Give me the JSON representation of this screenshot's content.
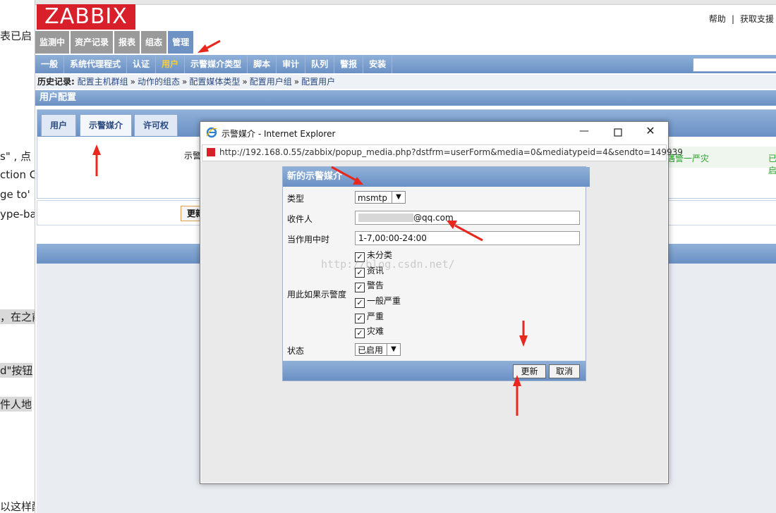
{
  "article_fragments": [
    "表已启",
    "s\" , 点",
    "ction C",
    "ge to'",
    "ype-ba",
    "，在之前",
    "d\"按钮",
    "件人地",
    "以这样配"
  ],
  "zabbix": {
    "logo": "ZABBIX",
    "top_links": {
      "help": "帮助",
      "separator": "|",
      "support": "获取支援"
    },
    "main_menu": [
      "监测中",
      "资产记录",
      "报表",
      "组态",
      "管理"
    ],
    "main_menu_active": "管理",
    "sub_menu": [
      "一般",
      "系统代理程式",
      "认证",
      "用户",
      "示警媒介类型",
      "脚本",
      "审计",
      "队列",
      "警报",
      "安装"
    ],
    "sub_menu_active": "用户",
    "history": {
      "label": "历史记录:",
      "crumbs": [
        "配置主机群组",
        "动作的组态",
        "配置媒体类型",
        "配置用户组",
        "配置用户"
      ],
      "separator": "»"
    },
    "page_title": "用户配置",
    "tabs": [
      "用户",
      "示警媒介",
      "许可权"
    ],
    "tabs_active": "示警媒介",
    "media_label_partial": "示警",
    "row_green_1": "遇警一严灾",
    "row_green_2": "已启",
    "update_button_partial": "更新"
  },
  "popup": {
    "window_title": "示警媒介 - Internet Explorer",
    "url": "http://192.168.0.55/zabbix/popup_media.php?dstfrm=userForm&media=0&mediatypeid=4&sendto=149939",
    "form": {
      "title": "新的示警媒介",
      "type_label": "类型",
      "type_value": "msmtp",
      "recipient_label": "收件人",
      "recipient_value": "@qq.com",
      "period_label": "当作用中时",
      "period_value": "1-7,00:00-24:00",
      "severity_label": "用此如果示警度",
      "severities": [
        "未分类",
        "资讯",
        "警告",
        "一般严重",
        "严重",
        "灾难"
      ],
      "status_label": "状态",
      "status_value": "已启用",
      "update_button": "更新",
      "cancel_button": "取消"
    },
    "watermark": "http://blog.csdn.net/"
  },
  "colors": {
    "zabbix_red": "#d8202a",
    "menu_blue": "#6a90c4",
    "active_yellow": "#ffcc33",
    "arrow_red": "#e8281e",
    "ok_green": "#25a125"
  }
}
